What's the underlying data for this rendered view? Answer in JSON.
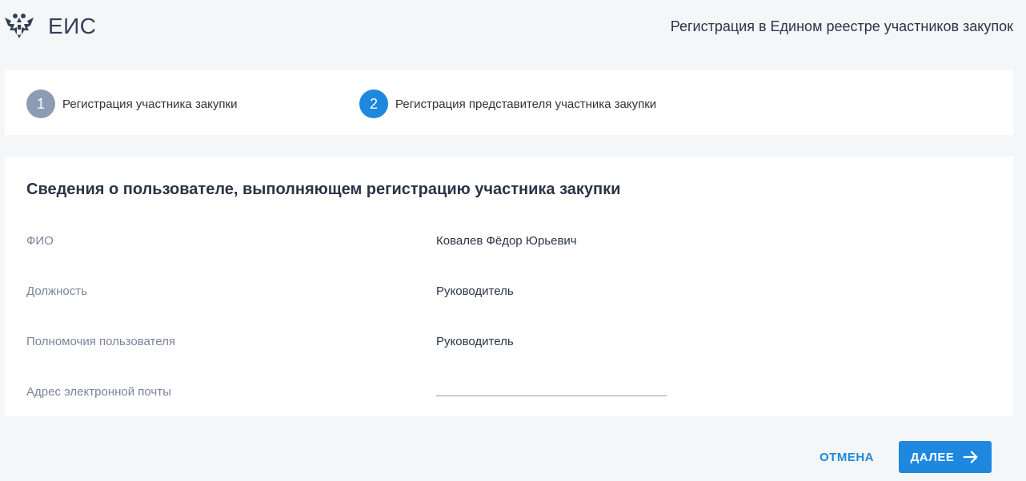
{
  "header": {
    "logo_icon": "coat-of-arms-icon",
    "logo_text": "ЕИС",
    "page_heading": "Регистрация в Едином реестре участников закупок"
  },
  "steps": [
    {
      "number": "1",
      "label": "Регистрация участника закупки",
      "state": "done"
    },
    {
      "number": "2",
      "label": "Регистрация представителя участника закупки",
      "state": "active"
    }
  ],
  "card": {
    "title": "Сведения о пользователе, выполняющем регистрацию участника закупки",
    "fields": {
      "fio": {
        "label": "ФИО",
        "value": "Ковалев Фёдор Юрьевич"
      },
      "position": {
        "label": "Должность",
        "value": "Руководитель"
      },
      "authority": {
        "label": "Полномочия пользователя",
        "value": "Руководитель"
      },
      "email": {
        "label": "Адрес электронной почты",
        "value": ""
      }
    }
  },
  "actions": {
    "cancel_label": "ОТМЕНА",
    "next_label": "ДАЛЕЕ",
    "next_icon": "arrow-right-icon"
  },
  "colors": {
    "accent": "#1e88de",
    "step_done": "#8e9bb5",
    "background": "#f5f6f8"
  }
}
